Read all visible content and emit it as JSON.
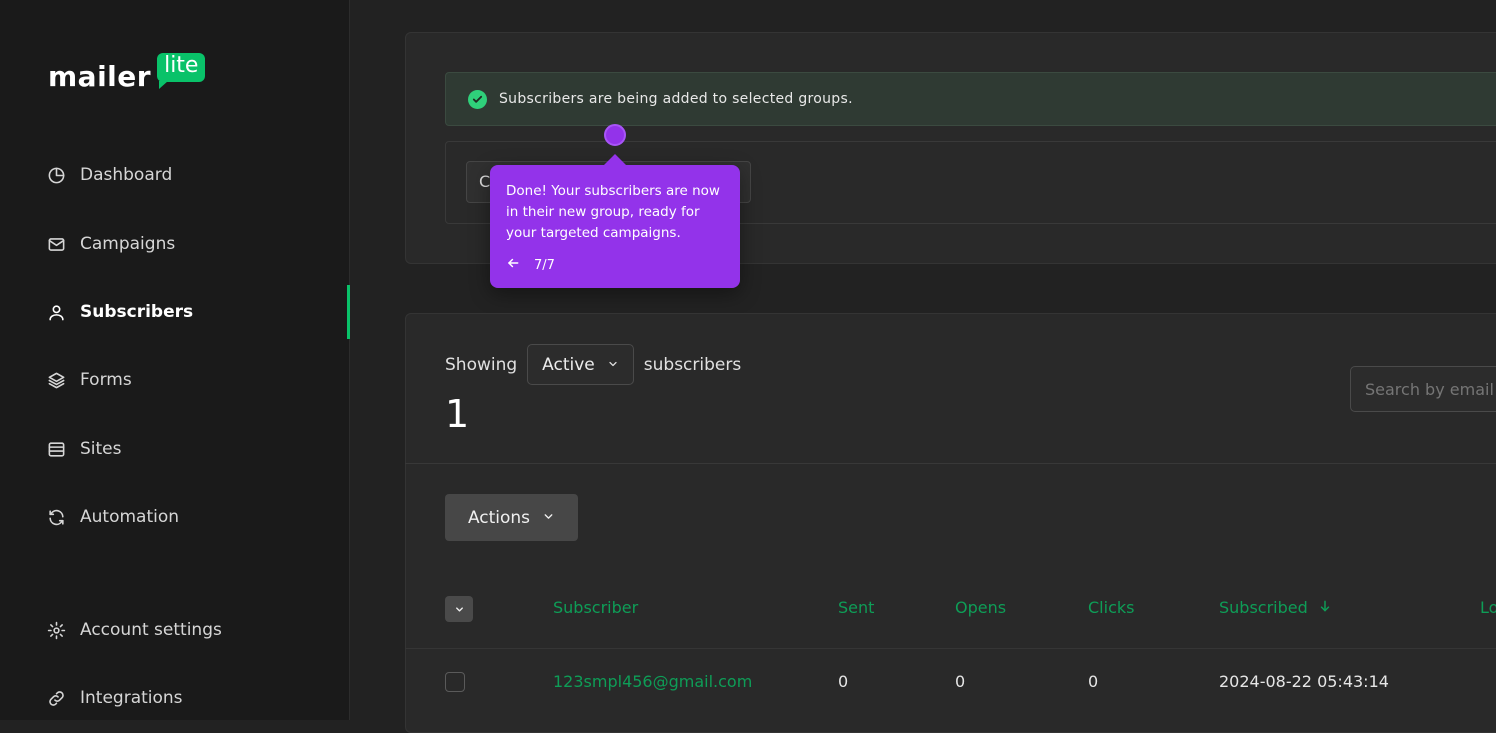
{
  "brand": {
    "word": "mailer",
    "badge": "lite",
    "accent": "#09c269"
  },
  "sidebar": {
    "items": [
      {
        "label": "Dashboard",
        "icon": "pie-chart-icon"
      },
      {
        "label": "Campaigns",
        "icon": "mail-icon"
      },
      {
        "label": "Subscribers",
        "icon": "user-icon",
        "active": true
      },
      {
        "label": "Forms",
        "icon": "layers-icon"
      },
      {
        "label": "Sites",
        "icon": "browser-window-icon"
      },
      {
        "label": "Automation",
        "icon": "refresh-icon"
      },
      {
        "label": "Account settings",
        "icon": "gear-icon"
      },
      {
        "label": "Integrations",
        "icon": "link-icon"
      }
    ]
  },
  "alert": {
    "message": "Subscribers are being added to selected groups.",
    "color": "#2fd07a"
  },
  "input": {
    "partial_text": "C"
  },
  "tooltip": {
    "text": "Done! Your subscribers are now in their new group, ready for your targeted campaigns.",
    "step": "7/7",
    "color": "#9333ea"
  },
  "list": {
    "showing_label": "Showing",
    "status": "Active",
    "suffix": "subscribers",
    "count": "1",
    "search_placeholder": "Search by email"
  },
  "toolbar": {
    "actions_label": "Actions"
  },
  "table": {
    "columns": [
      "Subscriber",
      "Sent",
      "Opens",
      "Clicks",
      "Subscribed",
      "Lo"
    ],
    "header_color": "#0e9d57",
    "rows": [
      {
        "subscriber": "123smpl456@gmail.com",
        "sent": "0",
        "opens": "0",
        "clicks": "0",
        "subscribed": "2024-08-22 05:43:14"
      }
    ]
  }
}
